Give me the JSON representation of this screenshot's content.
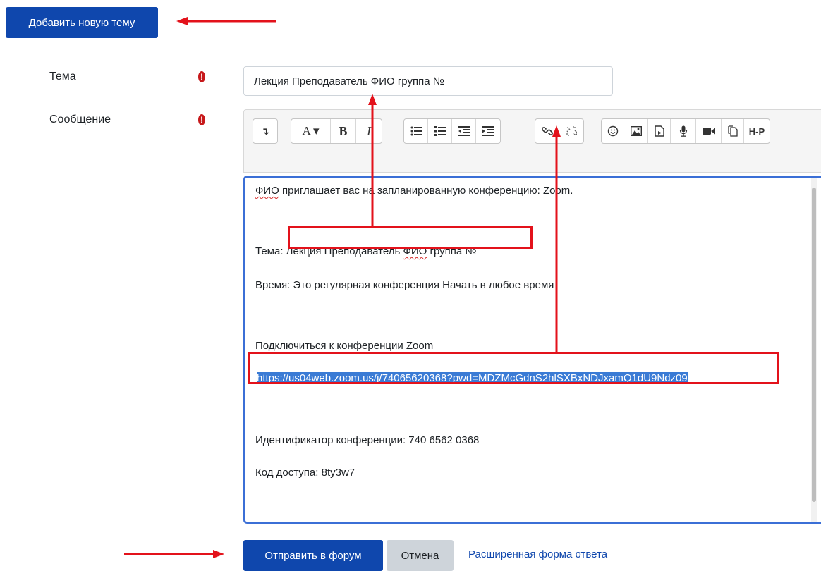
{
  "header": {
    "add_topic_label": "Добавить новую тему"
  },
  "form": {
    "subject_label": "Тема",
    "message_label": "Сообщение",
    "subject_value": "Лекция Преподаватель ФИО группа №",
    "required_icon": "exclamation-circle-icon"
  },
  "editor": {
    "toolbar": {
      "collapse": "↴",
      "font": "A ▾",
      "bold": "B",
      "italic": "I",
      "hp": "H-P"
    },
    "content": {
      "line1_fio": "ФИО",
      "line1_rest": " приглашает вас на запланированную конференцию: Zoom.",
      "line2_label": "Тема:",
      "line2_value_a": " Лекция Преподаватель ",
      "line2_value_fio": "ФИО",
      "line2_value_b": " группа №",
      "line3": "Время: Это регулярная конференция Начать в любое время",
      "line4": "Подключиться к конференции Zoom",
      "link": "https://us04web.zoom.us/j/74065620368?pwd=MDZMcGdnS2hlSXBxNDJxamQ1dU9Ndz09",
      "line5": "Идентификатор конференции: 740 6562 0368",
      "line6": "Код доступа: 8ty3w7"
    }
  },
  "footer": {
    "submit_label": "Отправить в форум",
    "cancel_label": "Отмена",
    "advanced_label": "Расширенная форма ответа"
  },
  "colors": {
    "primary": "#0f47ad",
    "annotation": "#e3121b",
    "required": "#c7191b",
    "editor_focus": "#3b6fd6"
  }
}
